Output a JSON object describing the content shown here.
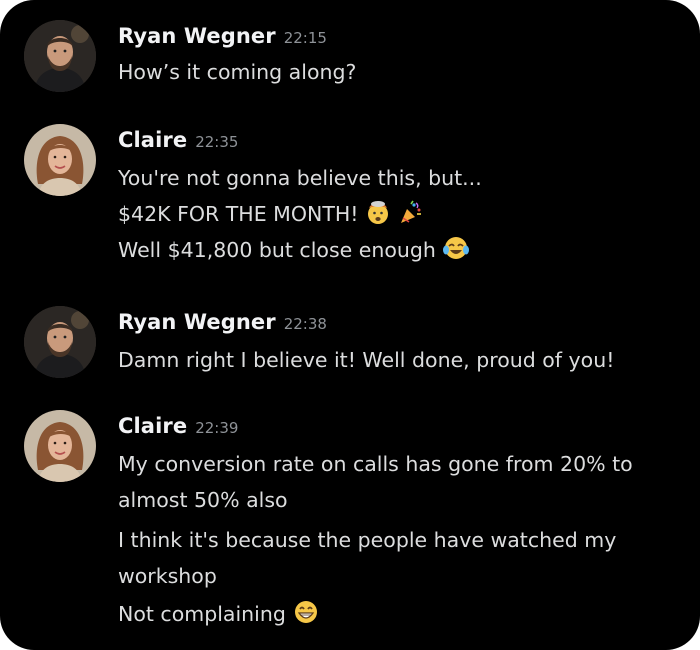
{
  "messages": [
    {
      "author": "Ryan Wegner",
      "time": "22:15",
      "avatar_icon": "ryan-avatar",
      "lines": [
        "How’s it coming along?"
      ]
    },
    {
      "author": "Claire",
      "time": "22:35",
      "avatar_icon": "claire-avatar",
      "lines": [
        "You're not gonna believe this, but...",
        "$42K FOR THE MONTH!",
        "Well $41,800 but close enough"
      ],
      "emojis": [
        "exploding-head-emoji",
        "party-popper-emoji",
        "tears-of-joy-emoji"
      ]
    },
    {
      "author": "Ryan Wegner",
      "time": "22:38",
      "avatar_icon": "ryan-avatar",
      "lines": [
        "Damn right I believe it! Well done, proud of you!"
      ]
    },
    {
      "author": "Claire",
      "time": "22:39",
      "avatar_icon": "claire-avatar",
      "lines": [
        "My conversion rate on calls has gone from 20% to",
        "almost 50% also",
        "I think it's because the people have watched my",
        "workshop",
        "Not complaining"
      ],
      "emojis": [
        "grinning-face-emoji"
      ]
    }
  ],
  "colors": {
    "background": "#000000",
    "author": "#f2f3f5",
    "message_text": "#dcddde",
    "timestamp": "#8e9297"
  }
}
